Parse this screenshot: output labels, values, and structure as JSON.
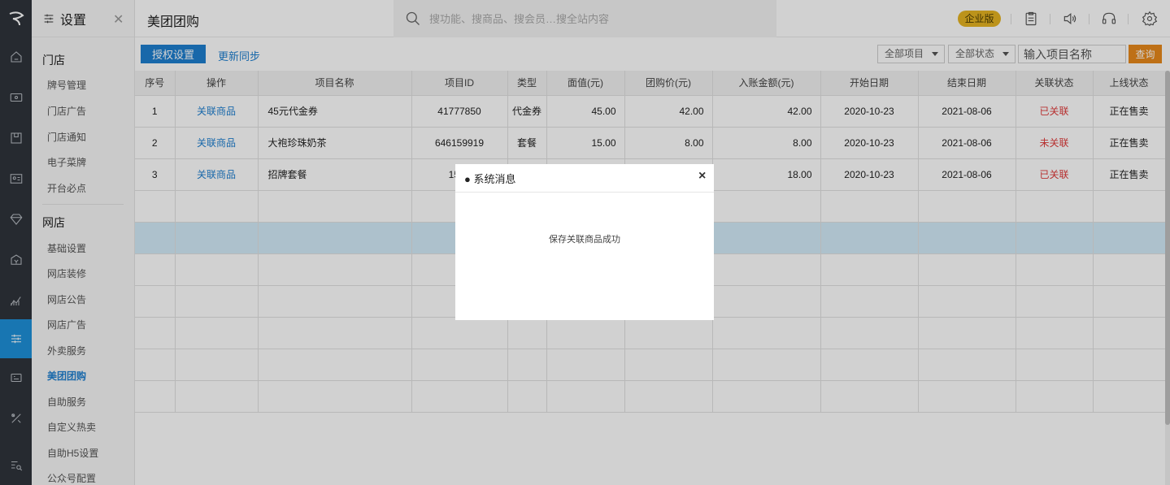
{
  "rail": {
    "items": [
      {
        "icon": "home-icon"
      },
      {
        "icon": "monitor-icon"
      },
      {
        "icon": "store-icon"
      },
      {
        "icon": "id-card-icon"
      },
      {
        "icon": "diamond-icon"
      },
      {
        "icon": "money-icon"
      },
      {
        "icon": "chart-icon"
      },
      {
        "icon": "sliders-icon",
        "active": true
      },
      {
        "icon": "cashier-icon"
      },
      {
        "icon": "tools-icon"
      },
      {
        "icon": "search-list-icon"
      }
    ]
  },
  "submenu": {
    "title": "设置",
    "groups": [
      {
        "label": "门店",
        "items": [
          "牌号管理",
          "门店广告",
          "门店通知",
          "电子菜牌",
          "开台必点"
        ]
      },
      {
        "label": "网店",
        "items": [
          "基础设置",
          "网店装修",
          "网店公告",
          "网店广告",
          "外卖服务",
          "美团团购",
          "自助服务",
          "自定义热卖",
          "自助H5设置",
          "公众号配置"
        ]
      }
    ],
    "active_item": "美团团购"
  },
  "topbar": {
    "page_title": "美团团购",
    "search_placeholder": "搜功能、搜商品、搜会员…搜全站内容",
    "badge": "企业版",
    "icons": [
      "clipboard-icon",
      "speaker-icon",
      "headset-icon",
      "settings-icon"
    ]
  },
  "toolbar": {
    "auth_button": "授权设置",
    "sync_link": "更新同步",
    "filter_project": "全部项目",
    "filter_status": "全部状态",
    "name_placeholder": "输入项目名称",
    "query_button": "查询"
  },
  "table": {
    "headers": [
      "序号",
      "操作",
      "项目名称",
      "项目ID",
      "类型",
      "面值(元)",
      "团购价(元)",
      "入账金额(元)",
      "开始日期",
      "结束日期",
      "关联状态",
      "上线状态"
    ],
    "rows": [
      {
        "no": "1",
        "action": "关联商品",
        "name": "45元代金券",
        "id": "41777850",
        "type": "代金券",
        "face": "45.00",
        "price": "42.00",
        "amount": "42.00",
        "start": "2020-10-23",
        "end": "2021-08-06",
        "link_status": "已关联",
        "online": "正在售卖"
      },
      {
        "no": "2",
        "action": "关联商品",
        "name": "大袍珍珠奶茶",
        "id": "646159919",
        "type": "套餐",
        "face": "15.00",
        "price": "8.00",
        "amount": "8.00",
        "start": "2020-10-23",
        "end": "2021-08-06",
        "link_status": "未关联",
        "online": "正在售卖"
      },
      {
        "no": "3",
        "action": "关联商品",
        "name": "招牌套餐",
        "id": "1599",
        "type": "",
        "face": "",
        "price": "",
        "amount": "18.00",
        "start": "2020-10-23",
        "end": "2021-08-06",
        "link_status": "已关联",
        "online": "正在售卖"
      }
    ]
  },
  "modal": {
    "title": "● 系统消息",
    "close": "×",
    "message": "保存关联商品成功"
  },
  "colors": {
    "primary": "#1e7fd0",
    "badge": "#e6b422",
    "query": "#e8891b",
    "linked_red": "#e03b3b",
    "highlight_row": "#d4ecf9",
    "rail": "#2f343b"
  }
}
